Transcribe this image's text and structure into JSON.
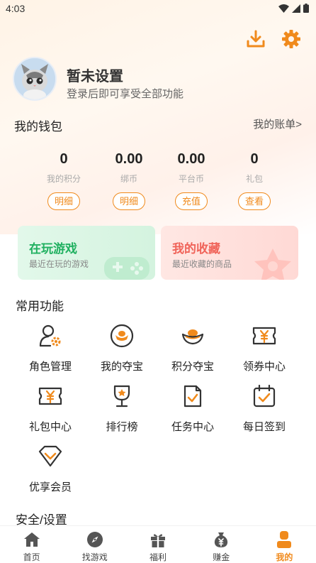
{
  "status": {
    "time": "4:03"
  },
  "colors": {
    "accent": "#f08a1c",
    "green": "#20b060",
    "pink": "#f0645a"
  },
  "top_actions": {
    "download_icon": "download-icon",
    "settings_icon": "gear-icon"
  },
  "profile": {
    "name": "暂未设置",
    "subtitle": "登录后即可享受全部功能"
  },
  "wallet": {
    "title": "我的钱包",
    "link": "我的账单>",
    "items": [
      {
        "value": "0",
        "label": "我的积分",
        "button": "明细"
      },
      {
        "value": "0.00",
        "label": "绑币",
        "button": "明细"
      },
      {
        "value": "0.00",
        "label": "平台币",
        "button": "充值"
      },
      {
        "value": "0",
        "label": "礼包",
        "button": "查看"
      }
    ]
  },
  "cards": [
    {
      "title": "在玩游戏",
      "subtitle": "最近在玩的游戏"
    },
    {
      "title": "我的收藏",
      "subtitle": "最近收藏的商品"
    }
  ],
  "common": {
    "title": "常用功能",
    "items": [
      {
        "label": "角色管理",
        "icon": "role-manage-icon"
      },
      {
        "label": "我的夺宝",
        "icon": "treasure-icon"
      },
      {
        "label": "积分夺宝",
        "icon": "ingot-icon"
      },
      {
        "label": "领券中心",
        "icon": "coupon-icon"
      },
      {
        "label": "礼包中心",
        "icon": "gift-ticket-icon"
      },
      {
        "label": "排行榜",
        "icon": "trophy-icon"
      },
      {
        "label": "任务中心",
        "icon": "task-icon"
      },
      {
        "label": "每日签到",
        "icon": "checkin-icon"
      },
      {
        "label": "优享会员",
        "icon": "vip-diamond-icon"
      }
    ]
  },
  "security": {
    "title": "安全/设置"
  },
  "nav": {
    "items": [
      {
        "label": "首页",
        "icon": "home-icon"
      },
      {
        "label": "找游戏",
        "icon": "compass-icon"
      },
      {
        "label": "福利",
        "icon": "gift-icon"
      },
      {
        "label": "赚金",
        "icon": "money-bag-icon"
      },
      {
        "label": "我的",
        "icon": "user-icon"
      }
    ],
    "active": "我的"
  }
}
